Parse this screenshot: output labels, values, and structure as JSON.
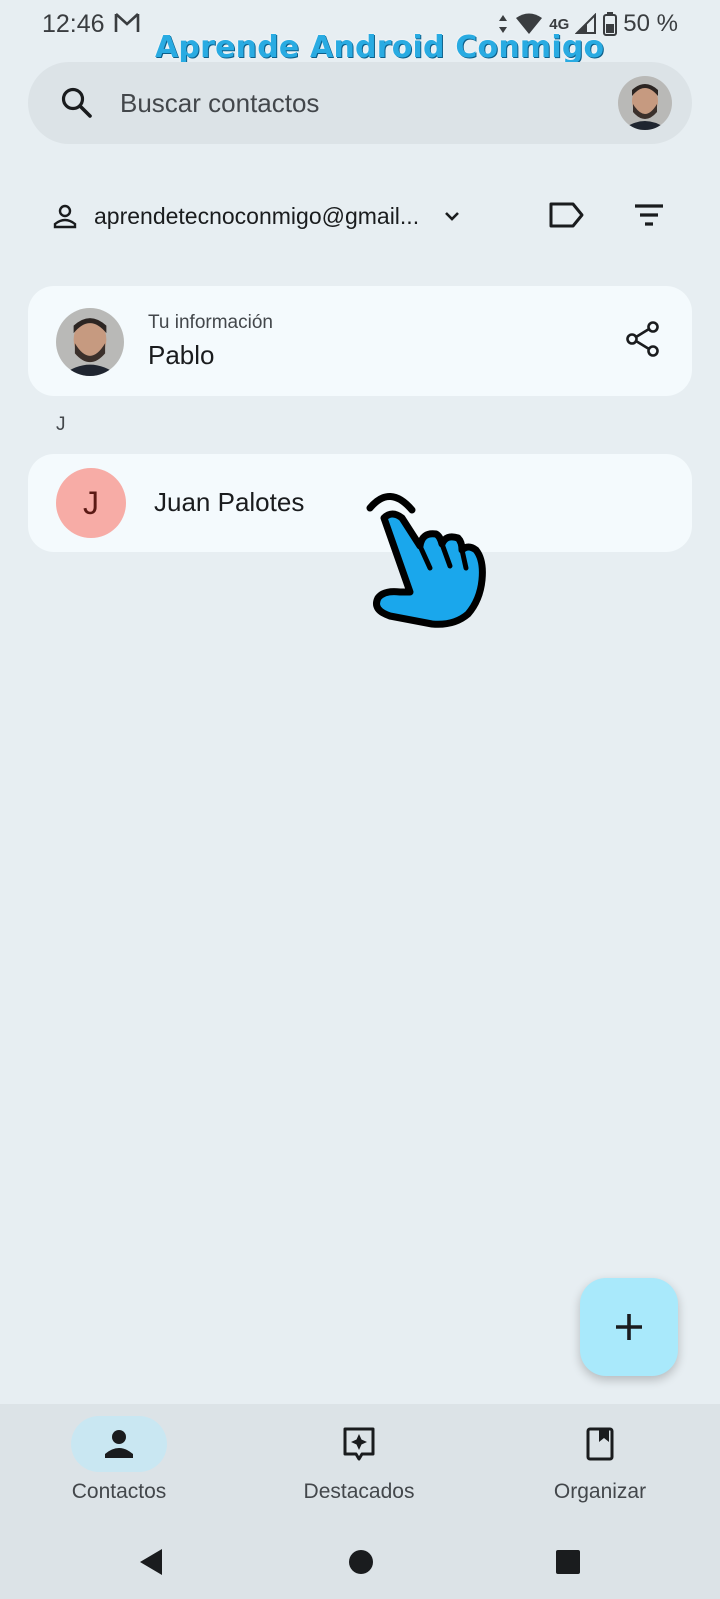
{
  "status_bar": {
    "time": "12:46",
    "network": "4G",
    "battery": "50 %",
    "icons": [
      "gmail-icon",
      "data-arrows-icon",
      "wifi-icon",
      "signal-icon",
      "battery-icon"
    ]
  },
  "watermark": "Aprende Android Conmigo",
  "search": {
    "placeholder": "Buscar contactos",
    "icon": "search-icon"
  },
  "account": {
    "email": "aprendetecnoconmigo@gmail...",
    "icons": [
      "person-icon",
      "chevron-down-icon",
      "label-icon",
      "filter-icon"
    ]
  },
  "my_info": {
    "caption": "Tu información",
    "name": "Pablo",
    "icon": "share-icon"
  },
  "section_letter": "J",
  "contacts": [
    {
      "initial": "J",
      "name": "Juan Palotes",
      "avatar_color": "#f7aca6"
    }
  ],
  "fab": {
    "icon": "add-icon"
  },
  "bottom_nav": {
    "items": [
      {
        "label": "Contactos",
        "icon": "person-icon",
        "active": true
      },
      {
        "label": "Destacados",
        "icon": "highlights-icon",
        "active": false
      },
      {
        "label": "Organizar",
        "icon": "bookmark-icon",
        "active": false
      }
    ]
  },
  "system_nav": {
    "icons": [
      "back-icon",
      "home-icon",
      "recents-icon"
    ]
  },
  "colors": {
    "background": "#e7eef2",
    "card": "#f4fafd",
    "fab": "#a9e9fb",
    "active_nav": "#c9e7f2",
    "watermark": "#29abe2",
    "hand": "#1aa7ec"
  }
}
